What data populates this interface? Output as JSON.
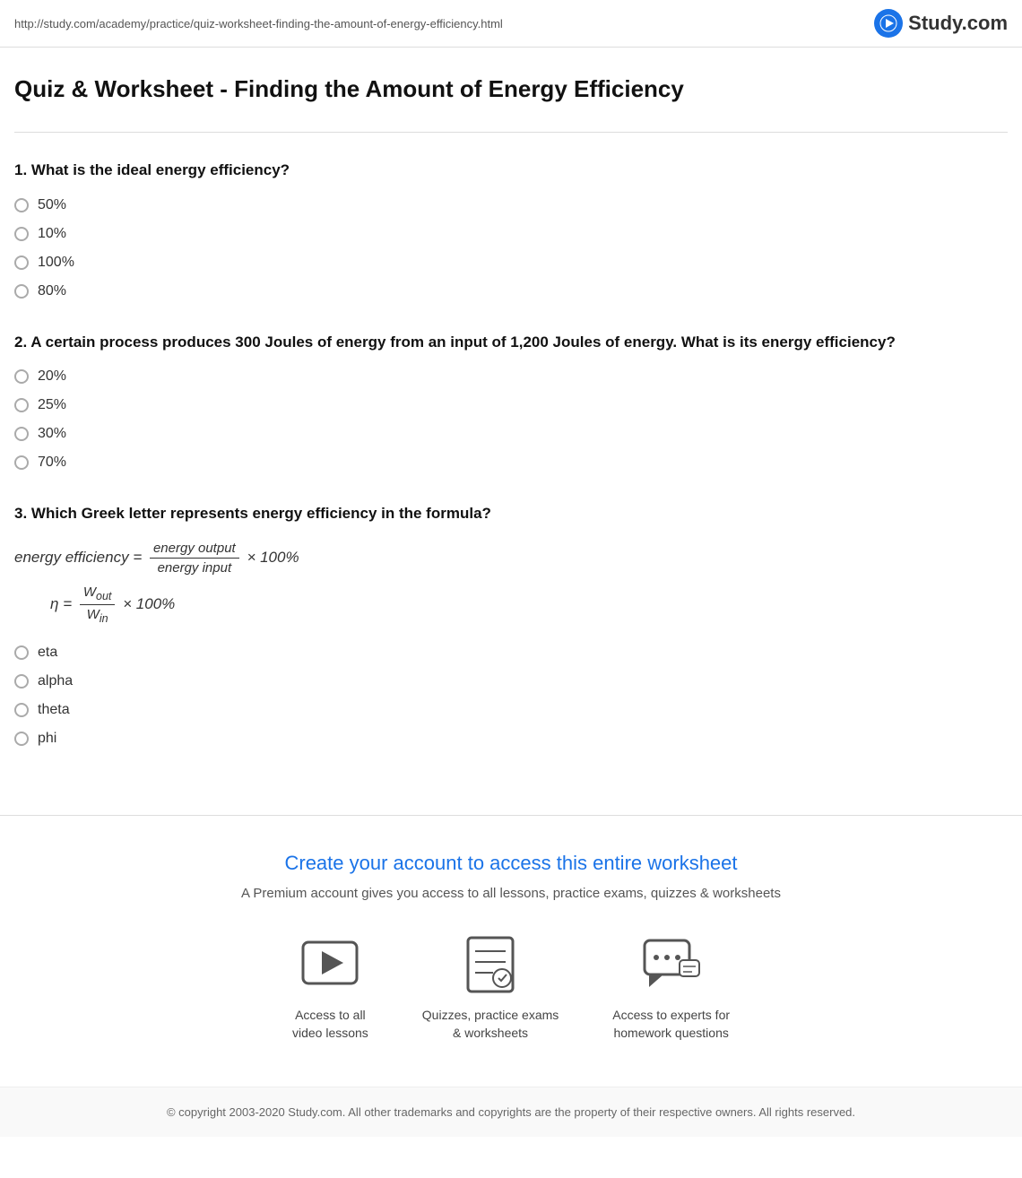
{
  "topbar": {
    "url": "http://study.com/academy/practice/quiz-worksheet-finding-the-amount-of-energy-efficiency.html",
    "logo_text": "Study.com"
  },
  "page": {
    "title": "Quiz & Worksheet - Finding the Amount of Energy Efficiency"
  },
  "questions": [
    {
      "number": "1.",
      "text": "What is the ideal energy efficiency?",
      "options": [
        "50%",
        "10%",
        "100%",
        "80%"
      ]
    },
    {
      "number": "2.",
      "text": "A certain process produces 300 Joules of energy from an input of 1,200 Joules of energy. What is its energy efficiency?",
      "options": [
        "20%",
        "25%",
        "30%",
        "70%"
      ]
    },
    {
      "number": "3.",
      "text": "Which Greek letter represents energy efficiency in the formula?",
      "options": [
        "eta",
        "alpha",
        "theta",
        "phi"
      ]
    }
  ],
  "cta": {
    "title": "Create your account to access this entire worksheet",
    "subtitle": "A Premium account gives you access to all lessons, practice exams, quizzes & worksheets"
  },
  "features": [
    {
      "label": "Access to all\nvideo lessons",
      "icon": "video"
    },
    {
      "label": "Quizzes, practice exams\n& worksheets",
      "icon": "quiz"
    },
    {
      "label": "Access to experts for\nhomework questions",
      "icon": "chat"
    }
  ],
  "footer": {
    "text": "© copyright 2003-2020 Study.com. All other trademarks and copyrights are the property of their respective owners. All rights reserved."
  }
}
